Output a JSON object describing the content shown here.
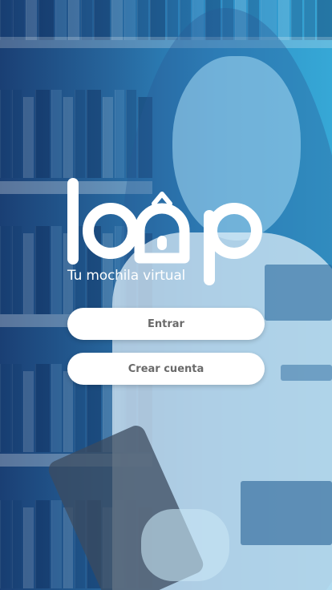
{
  "app": {
    "logo_text": "loop",
    "tagline": "Tu mochila virtual"
  },
  "buttons": {
    "enter_label": "Entrar",
    "create_account_label": "Crear cuenta"
  },
  "colors": {
    "overlay_left": "#1a3f74",
    "overlay_right": "#36a8d6",
    "button_bg": "#ffffff",
    "button_text": "#6a6a6a"
  },
  "icons": {
    "logo": "loop-backpack-logo"
  }
}
